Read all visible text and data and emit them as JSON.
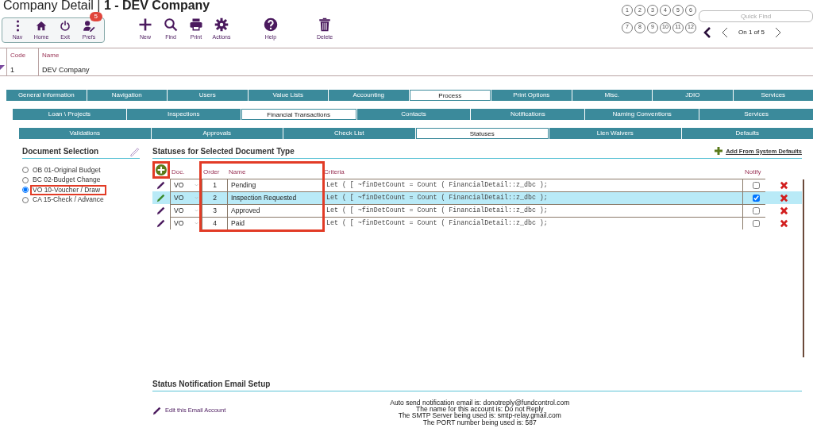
{
  "window": {
    "title_prefix": "Company Detail | ",
    "title_record": "1 - DEV Company"
  },
  "toolbar": {
    "group": [
      {
        "label": "Nav"
      },
      {
        "label": "Home"
      },
      {
        "label": "Exit"
      },
      {
        "label": "Prefs",
        "badge": "5"
      }
    ],
    "actions": [
      {
        "label": "New"
      },
      {
        "label": "Find"
      },
      {
        "label": "Print"
      },
      {
        "label": "Actions"
      },
      {
        "label": "Help"
      },
      {
        "label": "Delete"
      }
    ]
  },
  "record_nav": {
    "page_buttons": [
      "1",
      "2",
      "3",
      "4",
      "5",
      "6",
      "7",
      "8",
      "9",
      "10",
      "11",
      "12"
    ],
    "quick_find_placeholder": "Quick Find",
    "position": "On 1 of 5"
  },
  "record": {
    "code_label": "Code",
    "code": "1",
    "name_label": "Name",
    "name": "DEV Company"
  },
  "tabs_main": [
    {
      "label": "General Information",
      "selected": false
    },
    {
      "label": "Navigation",
      "selected": false
    },
    {
      "label": "Users",
      "selected": false
    },
    {
      "label": "Value Lists",
      "selected": false
    },
    {
      "label": "Accounting",
      "selected": false
    },
    {
      "label": "Process",
      "selected": true
    },
    {
      "label": "Print Options",
      "selected": false
    },
    {
      "label": "Misc.",
      "selected": false
    },
    {
      "label": "JDIO",
      "selected": false
    },
    {
      "label": "Services",
      "selected": false
    }
  ],
  "tabs_sub": [
    {
      "label": "Loan \\ Projects",
      "selected": false
    },
    {
      "label": "Inspections",
      "selected": false
    },
    {
      "label": "Financial Transactions",
      "selected": true
    },
    {
      "label": "Contacts",
      "selected": false
    },
    {
      "label": "Notifications",
      "selected": false
    },
    {
      "label": "Naming Conventions",
      "selected": false
    },
    {
      "label": "Services",
      "selected": false
    }
  ],
  "tabs_process": [
    {
      "label": "Validations",
      "selected": false
    },
    {
      "label": "Approvals",
      "selected": false
    },
    {
      "label": "Check List",
      "selected": false
    },
    {
      "label": "Statuses",
      "selected": true
    },
    {
      "label": "Lien Waivers",
      "selected": false
    },
    {
      "label": "Defaults",
      "selected": false
    }
  ],
  "document_selection": {
    "title": "Document Selection",
    "items": [
      {
        "label": "OB 01-Original Budget",
        "selected": false,
        "highlighted": false
      },
      {
        "label": "BC 02-Budget Change",
        "selected": false,
        "highlighted": false
      },
      {
        "label": "VO 10-Voucher / Draw",
        "selected": true,
        "highlighted": true
      },
      {
        "label": "CA 15-Check / Advance",
        "selected": false,
        "highlighted": false
      }
    ]
  },
  "statuses": {
    "title": "Statuses for Selected Document Type",
    "add_defaults": "Add From System Defaults",
    "add_button": {
      "highlighted": true
    },
    "columns": [
      {
        "label": "Doc.",
        "highlighted": false
      },
      {
        "label": "Order",
        "highlighted": true
      },
      {
        "label": "Name",
        "highlighted": true
      },
      {
        "label": "Criteria",
        "highlighted": false
      },
      {
        "label": "Notify",
        "highlighted": false
      }
    ],
    "rows": [
      {
        "doc": "VO",
        "order": "1",
        "name": "Pending",
        "criteria": "Let ( [ ~finDetCount = Count ( FinancialDetail::z_dbc );",
        "notify": false,
        "selected": false
      },
      {
        "doc": "VO",
        "order": "2",
        "name": "Inspection Requested",
        "criteria": "Let ( [ ~finDetCount = Count ( FinancialDetail::z_dbc );",
        "notify": true,
        "selected": true
      },
      {
        "doc": "VO",
        "order": "3",
        "name": "Approved",
        "criteria": "Let ( [ ~finDetCount = Count ( FinancialDetail::z_dbc );",
        "notify": false,
        "selected": false
      },
      {
        "doc": "VO",
        "order": "4",
        "name": "Paid",
        "criteria": "Let ( [ ~finDetCount = Count ( FinancialDetail::z_dbc );",
        "notify": false,
        "selected": false
      }
    ]
  },
  "email_setup": {
    "title": "Status Notification Email Setup",
    "edit_link": "Edit this Email Account",
    "lines": [
      "Auto send notification email is: donotreply@fundcontrol.com",
      "The name for this account is: Do not Reply",
      "The SMTP Server being used is: smtp-relay.gmail.com",
      "The PORT number being used is: 587"
    ]
  }
}
